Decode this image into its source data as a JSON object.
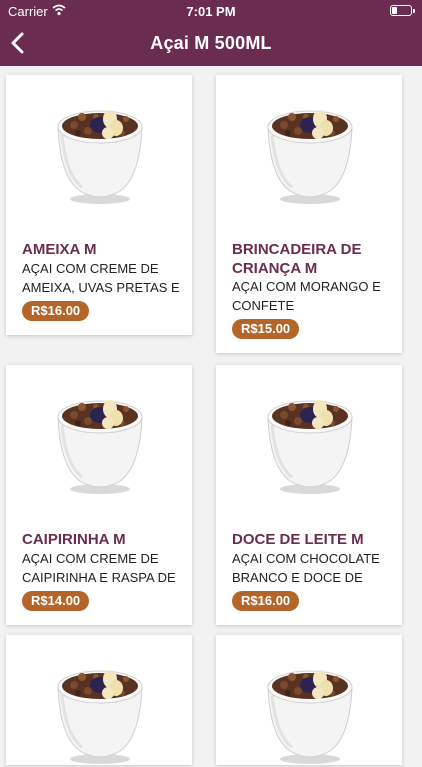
{
  "status": {
    "carrier": "Carrier",
    "time": "7:01 PM"
  },
  "nav": {
    "title": "Açai M 500ML"
  },
  "colors": {
    "header": "#6b2d4f",
    "product_name": "#6b2d4f",
    "price_badge": "#b3652a"
  },
  "products": [
    {
      "name": "AMEIXA M",
      "description": "AÇAI COM CREME DE AMEIXA, UVAS PRETAS E",
      "price": "R$16.00",
      "image_icon": "acai-bowl-icon"
    },
    {
      "name": "BRINCADEIRA DE CRIANÇA M",
      "description": "AÇAI COM MORANGO E CONFETE",
      "price": "R$15.00",
      "image_icon": "acai-bowl-icon"
    },
    {
      "name": "CAIPIRINHA M",
      "description": "AÇAI COM CREME DE CAIPIRINHA E RASPA DE",
      "price": "R$14.00",
      "image_icon": "acai-bowl-icon"
    },
    {
      "name": "DOCE DE LEITE M",
      "description": "AÇAI COM CHOCOLATE BRANCO E DOCE DE",
      "price": "R$16.00",
      "image_icon": "acai-bowl-icon"
    },
    {
      "name": "",
      "description": "",
      "price": "",
      "image_icon": "acai-bowl-icon"
    },
    {
      "name": "",
      "description": "",
      "price": "",
      "image_icon": "acai-bowl-icon"
    }
  ]
}
